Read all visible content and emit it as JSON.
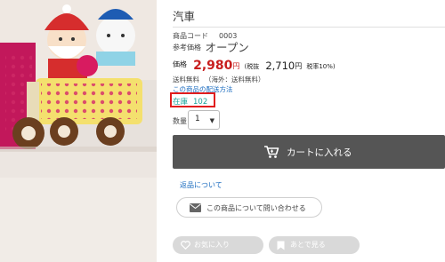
{
  "product": {
    "title": "汽車",
    "code_label": "商品コード",
    "code_value": "0003",
    "ref_label": "参考価格",
    "ref_value": "オープン",
    "price_label": "価格",
    "price_incl": "2,980",
    "price_unit": "円",
    "tax_incl_note": "(税抜",
    "price_excl": "2,710",
    "price_excl_unit": "円",
    "tax_note": "税率10%)",
    "shipping_label": "送料無料",
    "shipping_note": "（海外：送料無料）",
    "shipping_link": "この商品の配送方法",
    "stock_label": "在庫",
    "stock_value": "102",
    "qty_label": "数量",
    "qty_value": "1"
  },
  "actions": {
    "cart_label": "カートに入れる",
    "return_link": "返品について",
    "inquiry_label": "この商品について問い合わせる",
    "favorite_label": "お気に入り",
    "later_label": "あとで見る"
  },
  "colors": {
    "price": "#c81e1e",
    "stock": "#1aa39a",
    "link": "#1a6bbf",
    "cart_button": "#555555",
    "highlight_box": "#e11d1d"
  },
  "icons": {
    "cart": "cart-icon",
    "mail": "mail-icon",
    "heart": "heart-icon",
    "bookmark": "bookmark-icon",
    "caret": "chevron-down-icon"
  }
}
